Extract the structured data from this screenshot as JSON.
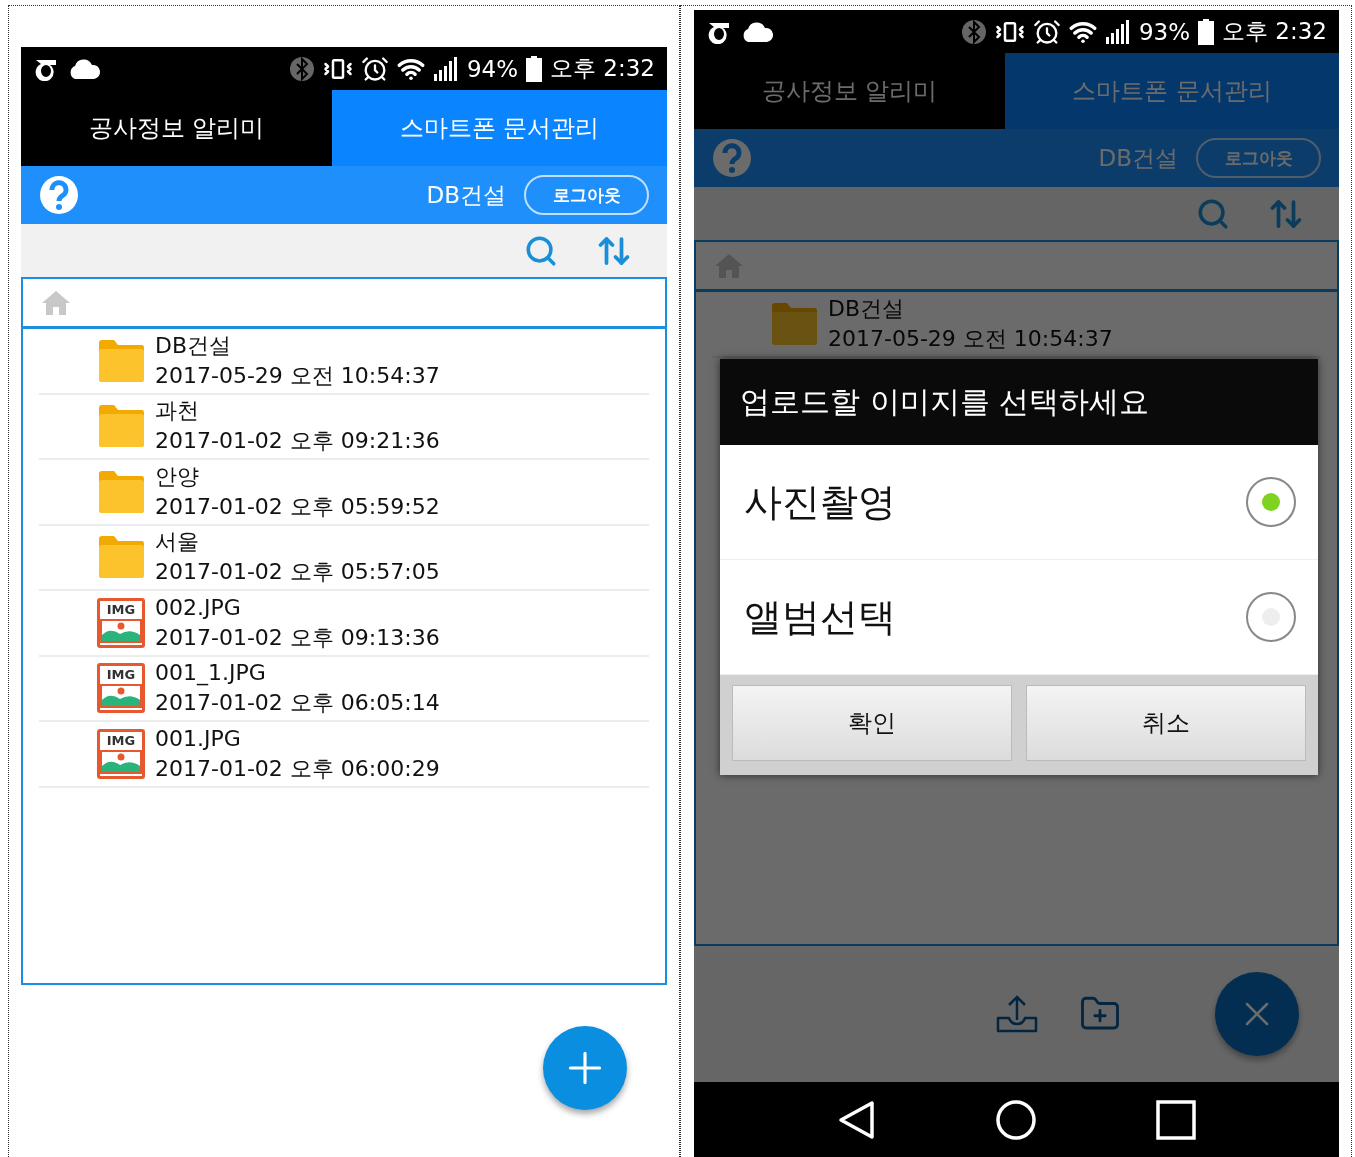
{
  "screens": [
    {
      "status_bar": {
        "battery": "94%",
        "time": "오후 2:32"
      },
      "tabs": [
        {
          "label": "공사정보 알리미",
          "selected": false
        },
        {
          "label": "스마트폰 문서관리",
          "selected": true
        }
      ],
      "header": {
        "company": "DB건설",
        "logout_button": "로그아웃"
      },
      "files": [
        {
          "kind": "folder",
          "name": "DB건설",
          "modified": "2017-05-29 오전 10:54:37"
        },
        {
          "kind": "folder",
          "name": "과천",
          "modified": "2017-01-02 오후 09:21:36"
        },
        {
          "kind": "folder",
          "name": "안양",
          "modified": "2017-01-02 오후 05:59:52"
        },
        {
          "kind": "folder",
          "name": "서울",
          "modified": "2017-01-02 오후 05:57:05"
        },
        {
          "kind": "image",
          "badge": "IMG",
          "name": "002.JPG",
          "modified": "2017-01-02 오후 09:13:36"
        },
        {
          "kind": "image",
          "badge": "IMG",
          "name": "001_1.JPG",
          "modified": "2017-01-02 오후 06:05:14"
        },
        {
          "kind": "image",
          "badge": "IMG",
          "name": "001.JPG",
          "modified": "2017-01-02 오후 06:00:29"
        }
      ],
      "fab_expanded": false
    },
    {
      "status_bar": {
        "battery": "93%",
        "time": "오후 2:32"
      },
      "tabs": [
        {
          "label": "공사정보 알리미",
          "selected": false
        },
        {
          "label": "스마트폰 문서관리",
          "selected": true
        }
      ],
      "header": {
        "company": "DB건설",
        "logout_button": "로그아웃"
      },
      "files": [
        {
          "kind": "folder",
          "name": "DB건설",
          "modified": "2017-05-29 오전 10:54:37"
        }
      ],
      "fab_expanded": true,
      "dialog": {
        "title": "업로드할 이미지를 선택하세요",
        "options": [
          {
            "label": "사진촬영",
            "selected": true
          },
          {
            "label": "앨범선택",
            "selected": false
          }
        ],
        "buttons": [
          "확인",
          "취소"
        ]
      },
      "navigation_bar": true
    }
  ]
}
